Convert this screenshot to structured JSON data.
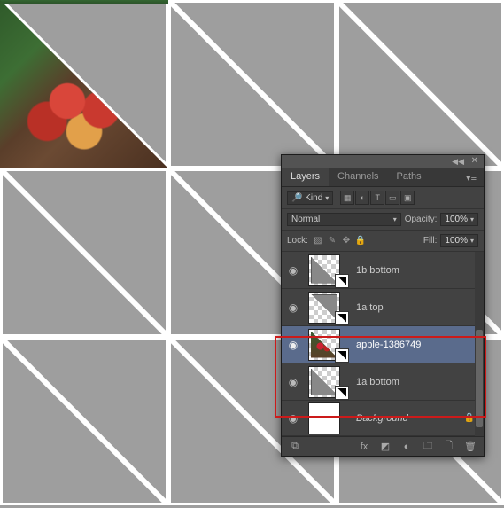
{
  "tabs": {
    "layers": "Layers",
    "channels": "Channels",
    "paths": "Paths"
  },
  "filter": {
    "kind": "Kind"
  },
  "blend": {
    "mode": "Normal",
    "opacity_label": "Opacity:",
    "opacity": "100%"
  },
  "lock": {
    "label": "Lock:",
    "fill_label": "Fill:",
    "fill": "100%"
  },
  "layers": [
    {
      "name": "1b bottom"
    },
    {
      "name": "1a top"
    },
    {
      "name": "apple-1386749"
    },
    {
      "name": "1a bottom"
    },
    {
      "name": "Background"
    }
  ],
  "icons": {
    "eye": "◉",
    "pixel": "▦",
    "adjust": "◐",
    "type": "T",
    "shape": "▭",
    "smart": "▣",
    "lock_trans": "▨",
    "brush": "✎",
    "move": "✥",
    "lock": "🔒",
    "link": "⧉",
    "fx": "fx",
    "mask": "◩",
    "fill": "◐",
    "group": "🗀",
    "new": "🗋",
    "trash": "🗑"
  }
}
